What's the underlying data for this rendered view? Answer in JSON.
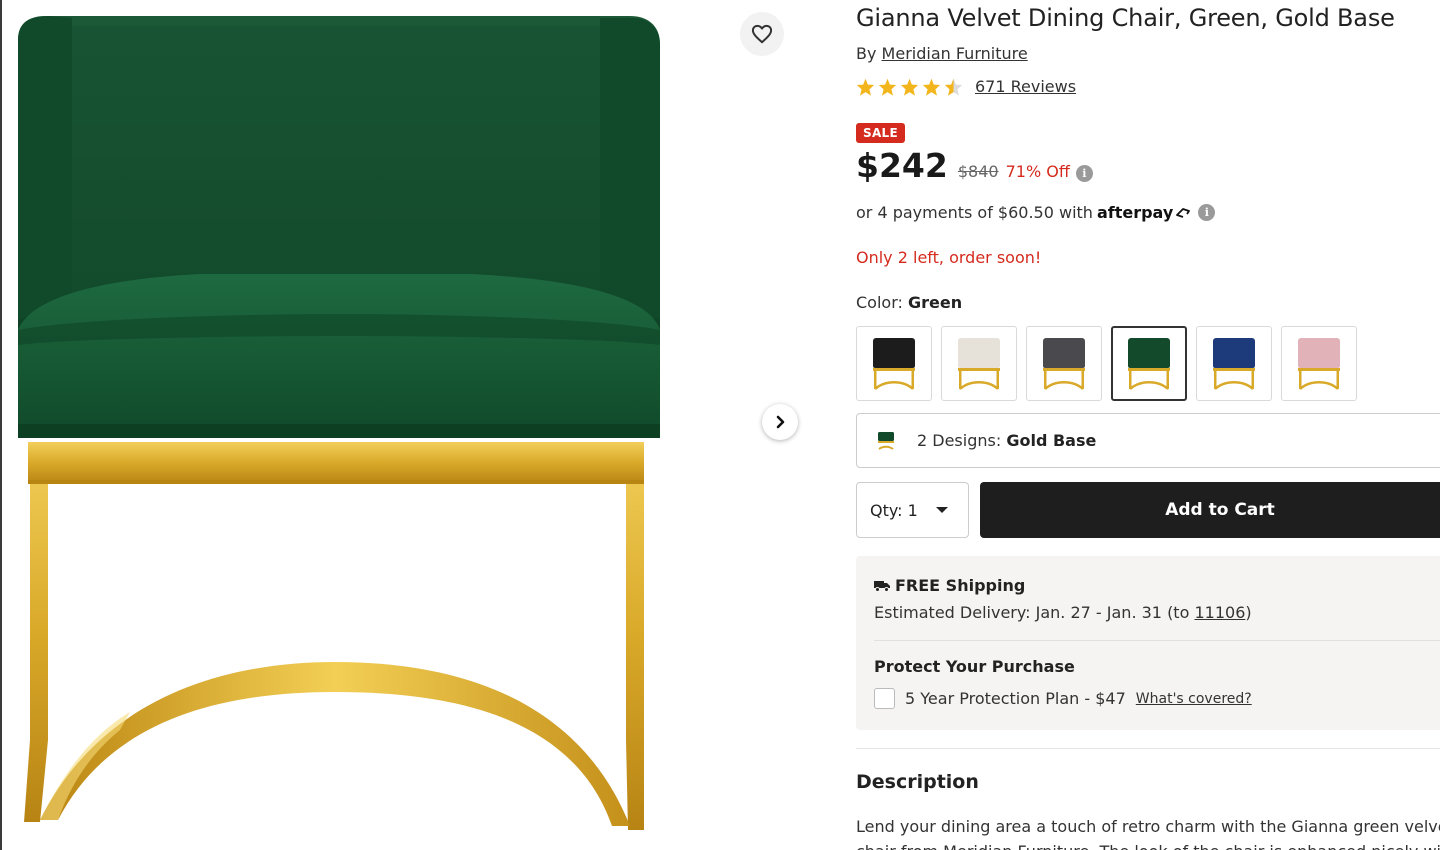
{
  "product": {
    "title": "Gianna Velvet Dining Chair, Green, Gold Base",
    "by_prefix": "By",
    "brand": "Meridian Furniture",
    "rating": 4.5,
    "reviews_label": "671 Reviews",
    "sale_badge": "SALE",
    "price": "$242",
    "original_price": "$840",
    "discount": "71% Off",
    "afterpay_text": "or 4 payments of $60.50 with",
    "afterpay_brand": "afterpay",
    "stock_message": "Only 2 left, order soon!",
    "color_label": "Color:",
    "color_value": "Green",
    "swatches": [
      {
        "name": "black",
        "seat": "#1c1c1c"
      },
      {
        "name": "cream",
        "seat": "#e6e1d9"
      },
      {
        "name": "grey",
        "seat": "#4a4a4e"
      },
      {
        "name": "green",
        "seat": "#134a2c",
        "selected": true
      },
      {
        "name": "navy",
        "seat": "#1d3a7a"
      },
      {
        "name": "pink",
        "seat": "#e1b2b8"
      }
    ],
    "designs_prefix": "2 Designs:",
    "designs_value": "Gold Base",
    "qty_label": "Qty: 1",
    "add_to_cart": "Add to Cart"
  },
  "shipping": {
    "title": "FREE Shipping",
    "delivery_prefix": "Estimated Delivery: Jan. 27 - Jan. 31 (to",
    "zip": "11106",
    "delivery_suffix": ")"
  },
  "protection": {
    "title": "Protect Your Purchase",
    "plan": "5 Year Protection Plan - $47",
    "covered_link": "What's covered?"
  },
  "description": {
    "heading": "Description",
    "line1": "Lend your dining area a touch of retro charm with the Gianna green velvet",
    "line2": "chair from Meridian Furniture. The look of the chair is enhanced nicely with"
  },
  "colors": {
    "sale_red": "#d52b1e",
    "velvet_green": "#134a2c",
    "gold": "#d9a929"
  }
}
